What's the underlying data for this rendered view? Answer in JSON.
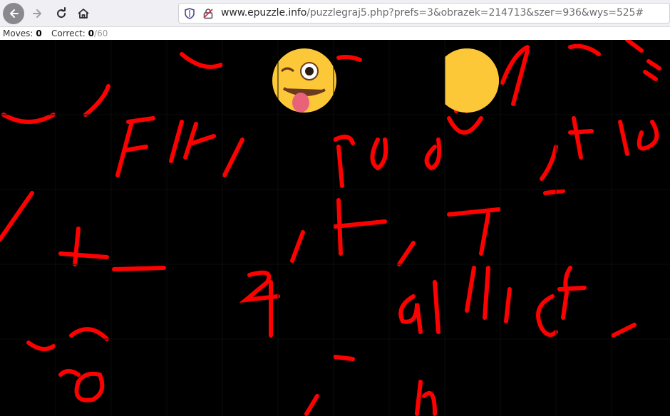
{
  "toolbar": {
    "url_host": "www.epuzzle.info",
    "url_path": "/puzzlegraj5.php?prefs=3&obrazek=214713&szer=936&wys=525#",
    "icons": {
      "back": "back-arrow-icon",
      "forward": "forward-arrow-icon",
      "reload": "reload-icon",
      "home": "home-icon",
      "shield": "shield-icon",
      "lock": "insecure-lock-icon"
    }
  },
  "status": {
    "moves_label": "Moves:",
    "moves_value": "0",
    "correct_label": "Correct:",
    "correct_value": "0",
    "correct_total": "/60"
  },
  "puzzle": {
    "columns": 12,
    "rows": 5,
    "stroke_color": "#ff0000",
    "background_color": "#000000",
    "emoji_color": "#fcc838"
  }
}
